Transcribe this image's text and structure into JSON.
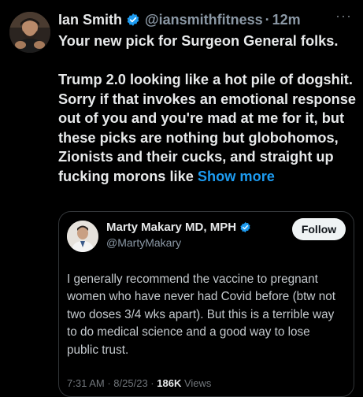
{
  "tweet": {
    "author": {
      "display_name": "Ian Smith",
      "handle": "@iansmithfitness",
      "verified": true,
      "avatar_icon": "avatar-photo"
    },
    "separator": "·",
    "timestamp": "12m",
    "more_label": "···",
    "body_paragraphs": [
      "Your new pick for Surgeon General folks.",
      "Trump 2.0 looking like a hot pile of dogshit. Sorry if that invokes an emotional response out of you and you're mad at me for it, but these picks are nothing but globohomos, Zionists and their cucks, and straight up fucking morons like"
    ],
    "show_more_label": "Show more"
  },
  "quoted_tweet": {
    "author": {
      "display_name": "Marty Makary MD, MPH",
      "handle": "@MartyMakary",
      "verified": true,
      "avatar_icon": "avatar-photo"
    },
    "follow_label": "Follow",
    "text": "I generally recommend the vaccine to pregnant women who have never had Covid before (btw not two doses 3/4 wks apart). But this is a terrible way to do medical science and a good way to lose public trust.",
    "meta": {
      "time": "7:31 AM",
      "separator": "·",
      "date": "8/25/23",
      "views_count": "186K",
      "views_label": "Views"
    }
  },
  "colors": {
    "background": "#000000",
    "text_primary": "#e7e9ea",
    "text_secondary": "#8b98a5",
    "link": "#1d9bf0",
    "verified_badge": "#1d9bf0",
    "border": "#333639",
    "follow_button_bg": "#eff3f4"
  }
}
